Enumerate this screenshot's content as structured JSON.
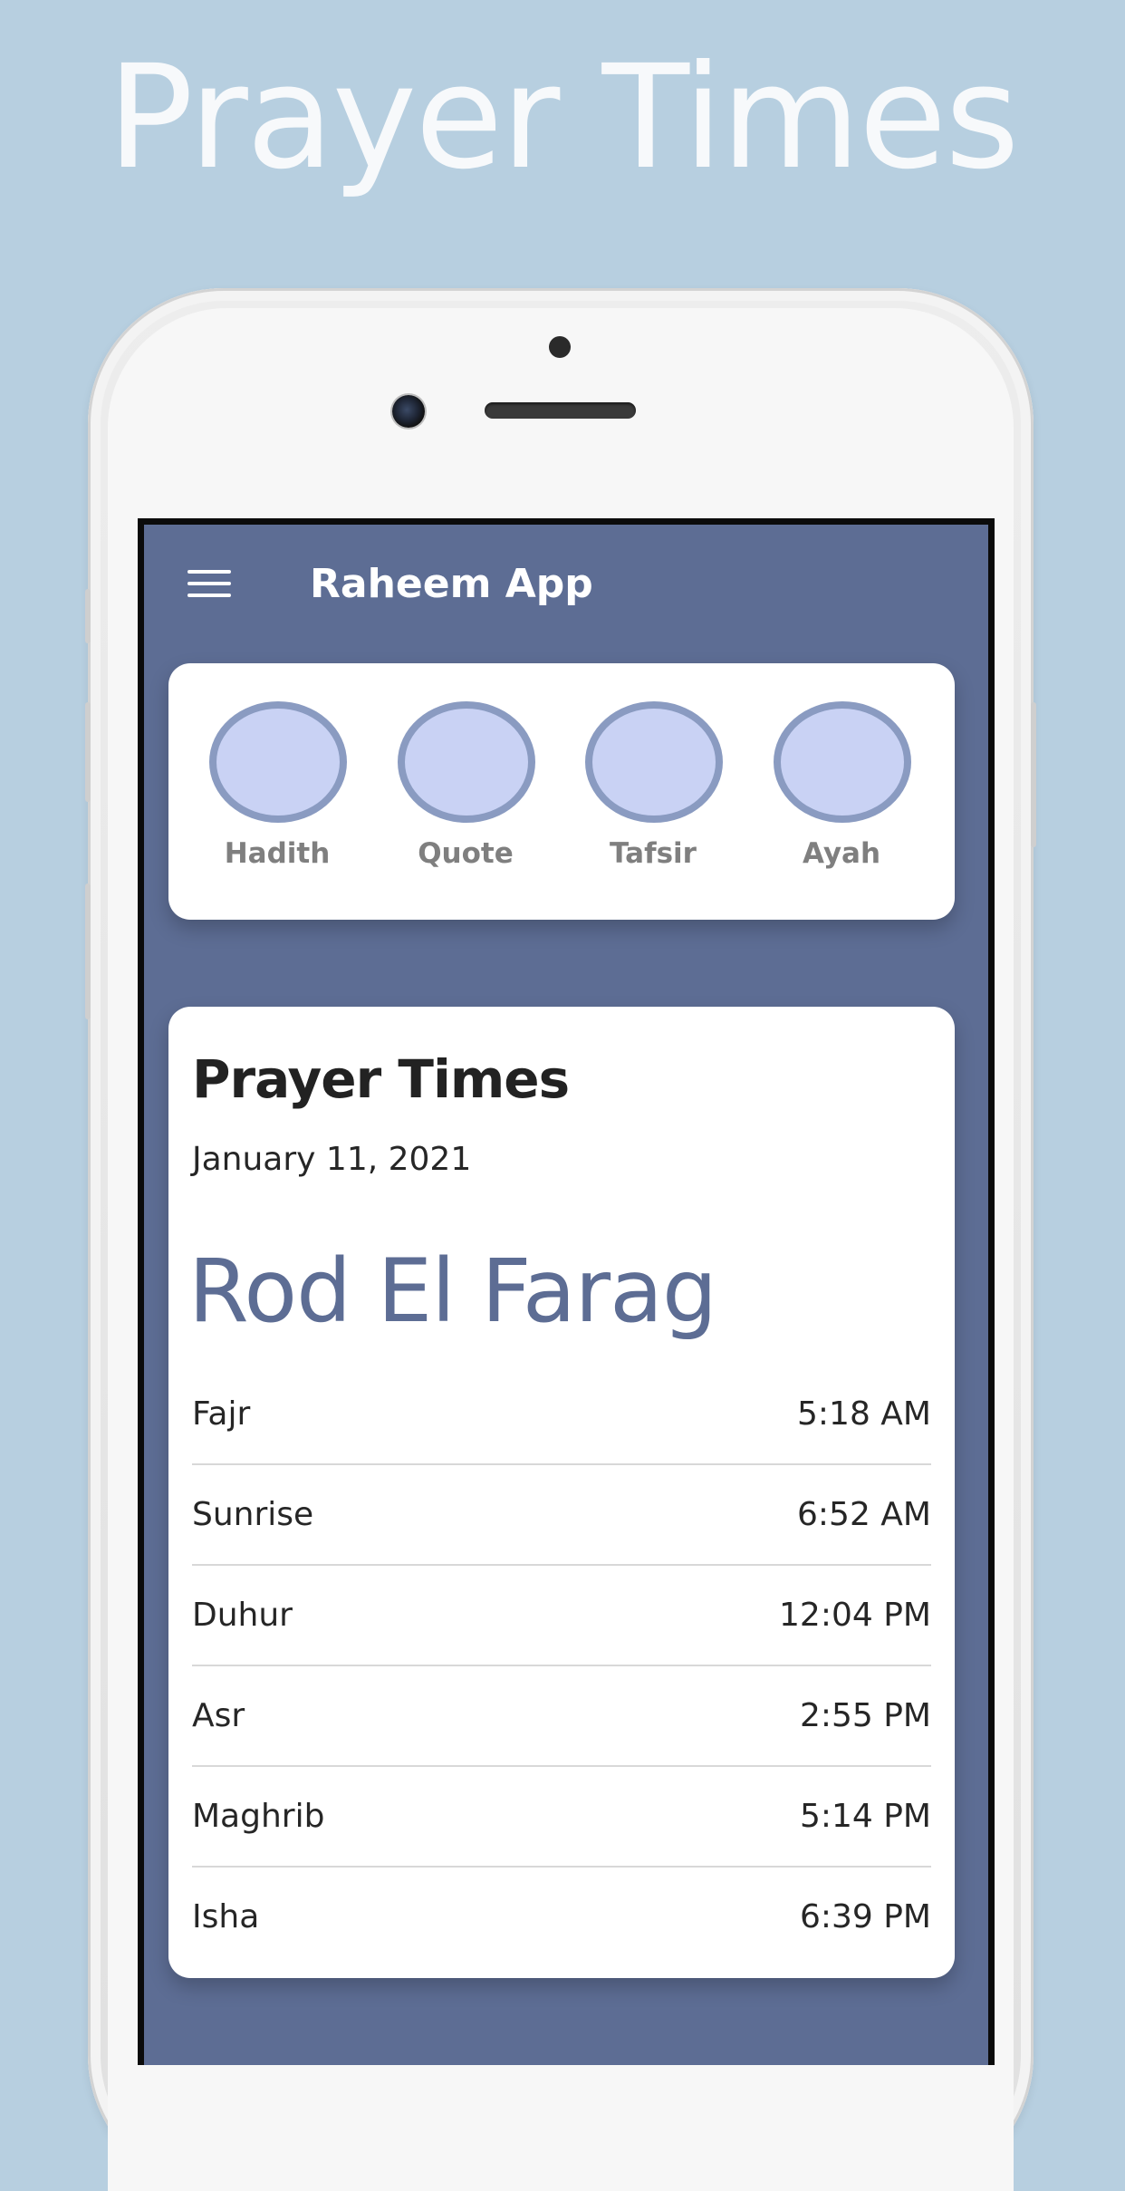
{
  "headline": "Prayer Times",
  "app": {
    "title": "Raheem App",
    "menu_icon": "hamburger-menu-icon"
  },
  "shortcuts": [
    {
      "label": "Hadith"
    },
    {
      "label": "Quote"
    },
    {
      "label": "Tafsir"
    },
    {
      "label": "Ayah"
    }
  ],
  "prayer_card": {
    "title": "Prayer Times",
    "date": "January 11, 2021",
    "city": "Rod El Farag",
    "prayers": [
      {
        "name": "Fajr",
        "time": "5:18 AM"
      },
      {
        "name": "Sunrise",
        "time": "6:52 AM"
      },
      {
        "name": "Duhur",
        "time": "12:04 PM"
      },
      {
        "name": "Asr",
        "time": "2:55 PM"
      },
      {
        "name": "Maghrib",
        "time": "5:14 PM"
      },
      {
        "name": "Isha",
        "time": "6:39 PM"
      }
    ]
  },
  "colors": {
    "background": "#b7cfe0",
    "app_bar": "#5d6d94",
    "shortcut_fill": "#c9d2f4",
    "shortcut_ring": "#8a9bc1",
    "city_text": "#5d6d94"
  }
}
